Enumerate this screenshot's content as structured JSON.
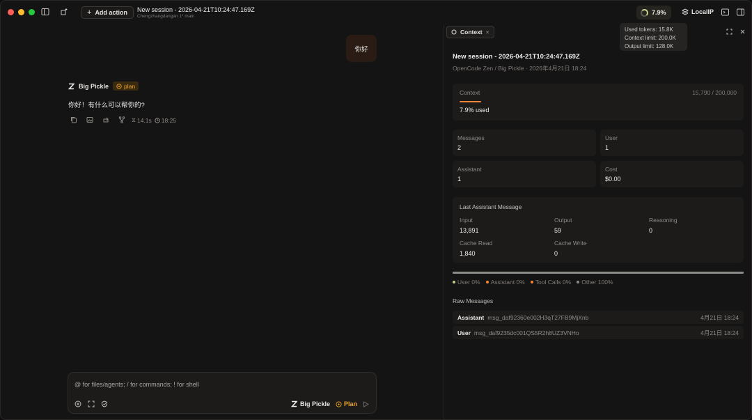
{
  "titlebar": {
    "add_action": "Add action",
    "session_title": "New session - 2026-04-21T10:24:47.169Z",
    "session_meta": "Chengzhangdangan  1* main",
    "context_pct": "7.9%",
    "local_ip": "LocalIP"
  },
  "tooltip": {
    "used_tokens": "Used tokens: 15.8K",
    "context_limit": "Context limit: 200.0K",
    "output_limit": "Output limit: 128.0K"
  },
  "chat": {
    "user_message": "你好",
    "agent_name": "Big Pickle",
    "agent_mode": "plan",
    "reply": "你好！有什么可以帮你的?",
    "duration": "14.1s",
    "time": "18:25"
  },
  "composer": {
    "placeholder": "@ for files/agents; / for commands; ! for shell",
    "model": "Big Pickle",
    "mode": "Plan"
  },
  "panel": {
    "tab_label": "Context",
    "title": "New session - 2026-04-21T10:24:47.169Z",
    "subtitle": "OpenCode Zen / Big Pickle  ·  2026年4月21日 18:24",
    "context": {
      "label": "Context",
      "count": "15,790 / 200,000",
      "used": "7.9% used",
      "fraction": 0.079
    },
    "stats": [
      {
        "label": "Messages",
        "value": "2"
      },
      {
        "label": "User",
        "value": "1"
      },
      {
        "label": "Assistant",
        "value": "1"
      },
      {
        "label": "Cost",
        "value": "$0.00"
      }
    ],
    "last_message": {
      "title": "Last Assistant Message",
      "cells": [
        {
          "label": "Input",
          "value": "13,891"
        },
        {
          "label": "Output",
          "value": "59"
        },
        {
          "label": "Reasoning",
          "value": "0"
        },
        {
          "label": "Cache Read",
          "value": "1,840"
        },
        {
          "label": "Cache Write",
          "value": "0"
        }
      ]
    },
    "breakdown": [
      {
        "label": "User 0%",
        "color": "#c9cf8b"
      },
      {
        "label": "Assistant 0%",
        "color": "#f2863a"
      },
      {
        "label": "Tool Calls 0%",
        "color": "#f2863a"
      },
      {
        "label": "Other 100%",
        "color": "#8e8c89"
      }
    ],
    "raw_title": "Raw Messages",
    "raw_messages": [
      {
        "role": "Assistant",
        "id": "msg_daf92360e002H3qT27FB9MjXnb",
        "time": "4月21日 18:24"
      },
      {
        "role": "User",
        "id": "msg_daf9235dc001QS5R2h8UZ3VNHo",
        "time": "4月21日 18:24"
      }
    ]
  },
  "colors": {
    "accent": "#f2863a",
    "plan": "#f0a52a",
    "ring": "#c9cf8b"
  }
}
